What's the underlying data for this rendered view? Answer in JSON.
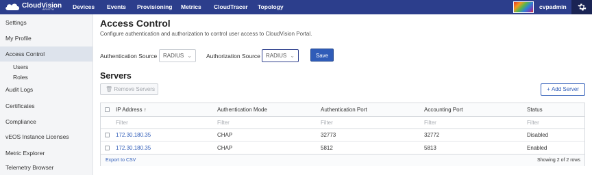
{
  "brand": {
    "name": "CloudVision",
    "sub": "ARISTA"
  },
  "nav": [
    "Devices",
    "Events",
    "Provisioning",
    "Metrics",
    "CloudTracer",
    "Topology"
  ],
  "user": {
    "name": "cvpadmin"
  },
  "sidebar": {
    "items": [
      {
        "label": "Settings"
      },
      {
        "label": "My Profile"
      },
      {
        "label": "Access Control"
      },
      {
        "label": "Users"
      },
      {
        "label": "Roles"
      },
      {
        "label": "Audit Logs"
      },
      {
        "label": "Certificates"
      },
      {
        "label": "Compliance"
      },
      {
        "label": "vEOS Instance Licenses"
      },
      {
        "label": "Metric Explorer"
      },
      {
        "label": "Telemetry Browser"
      }
    ]
  },
  "page": {
    "title": "Access Control",
    "description": "Configure authentication and authorization to control user access to CloudVision Portal.",
    "auth_source_label": "Authentication Source :",
    "auth_source_value": "RADIUS",
    "authz_source_label": "Authorization Source :",
    "authz_source_value": "RADIUS",
    "save_label": "Save",
    "servers_title": "Servers",
    "remove_label": "Remove Servers",
    "add_label": "Add Server"
  },
  "table": {
    "headers": [
      "IP Address",
      "Authentication Mode",
      "Authentication Port",
      "Accounting Port",
      "Status"
    ],
    "sort_icon": "↑",
    "filter_placeholder": "Filter",
    "rows": [
      [
        "172.30.180.35",
        "CHAP",
        "32773",
        "32772",
        "Disabled"
      ],
      [
        "172.30.180.35",
        "CHAP",
        "5812",
        "5813",
        "Enabled"
      ]
    ],
    "export_label": "Export to CSV",
    "count_label": "Showing 2 of 2 rows"
  },
  "colors": {
    "nav_bg": "#2c3e8c",
    "accent": "#2f5cb8",
    "sidebar_active": "#dde3ec"
  }
}
